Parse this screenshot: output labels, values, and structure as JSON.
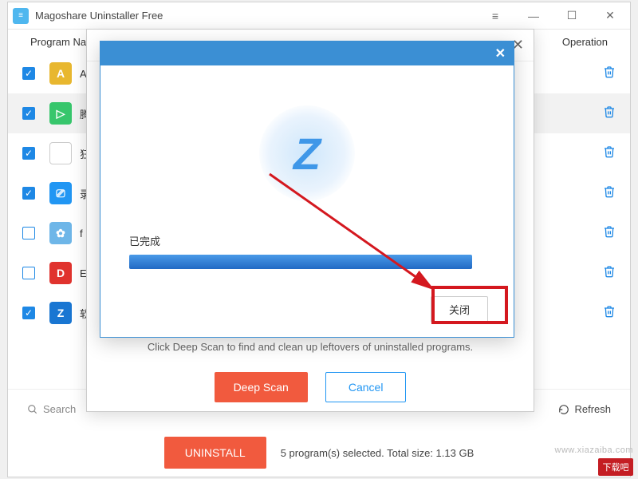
{
  "window": {
    "title": "Magoshare Uninstaller Free",
    "minimize": "—",
    "maximize": "☐",
    "close": "✕"
  },
  "header": {
    "name": "Program Na",
    "operation": "Operation"
  },
  "programs": [
    {
      "checked": true,
      "icon_bg": "#e8b72f",
      "icon_letter": "A",
      "label": "A",
      "selected": false
    },
    {
      "checked": true,
      "icon_bg": "#37c66c",
      "icon_letter": "▷",
      "label": "腾",
      "selected": true
    },
    {
      "checked": true,
      "icon_bg": "#ffffff",
      "icon_letter": "",
      "label": "狂",
      "selected": false,
      "border": true
    },
    {
      "checked": true,
      "icon_bg": "#2196f3",
      "icon_letter": "⎚",
      "label": "录",
      "selected": false
    },
    {
      "checked": false,
      "icon_bg": "#6eb6e8",
      "icon_letter": "✿",
      "label": "f",
      "selected": false
    },
    {
      "checked": false,
      "icon_bg": "#e0332e",
      "icon_letter": "D",
      "label": "E",
      "selected": false
    },
    {
      "checked": true,
      "icon_bg": "#1976d2",
      "icon_letter": "Z",
      "label": "软",
      "selected": false
    }
  ],
  "search": {
    "placeholder": "Search"
  },
  "refresh": {
    "label": "Refresh"
  },
  "uninstall": {
    "button": "UNINSTALL",
    "status": "5 program(s) selected. Total size: 1.13 GB"
  },
  "deepscan_modal": {
    "hint": "Click Deep Scan to find and clean up leftovers of uninstalled programs.",
    "deep": "Deep Scan",
    "cancel": "Cancel",
    "close": "✕"
  },
  "progress_modal": {
    "done": "已完成",
    "percent": 100,
    "close": "关闭",
    "title_close": "✕",
    "logo_letter": "Z"
  },
  "watermark": {
    "url": "www.xiazaiba.com",
    "badge": "下载吧"
  }
}
